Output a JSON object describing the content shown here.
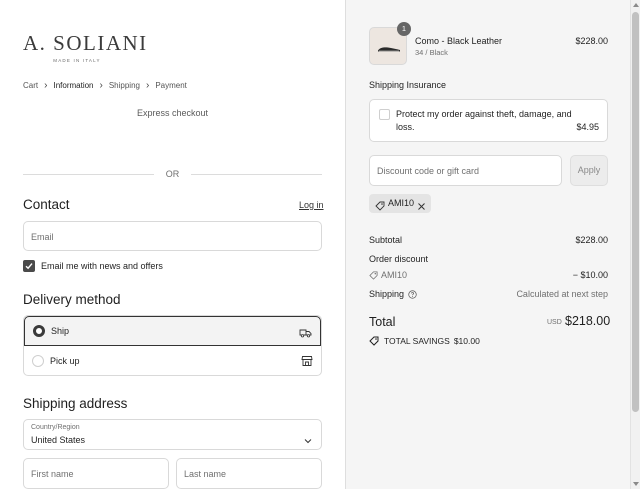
{
  "brand": {
    "name": "A. SOLIANI",
    "tagline": "MADE IN ITALY"
  },
  "breadcrumb": [
    {
      "label": "Cart",
      "active": false
    },
    {
      "label": "Information",
      "active": true
    },
    {
      "label": "Shipping",
      "active": false
    },
    {
      "label": "Payment",
      "active": false
    }
  ],
  "express_checkout": "Express checkout",
  "divider_or": "OR",
  "contact": {
    "heading": "Contact",
    "login_label": "Log in",
    "email_placeholder": "Email",
    "news_checkbox_label": "Email me with news and offers",
    "news_checked": true
  },
  "delivery": {
    "heading": "Delivery method",
    "options": [
      {
        "label": "Ship",
        "selected": true,
        "icon": "truck-icon"
      },
      {
        "label": "Pick up",
        "selected": false,
        "icon": "store-icon"
      }
    ]
  },
  "shipping_address": {
    "heading": "Shipping address",
    "country_label": "Country/Region",
    "country_value": "United States",
    "first_name_placeholder": "First name",
    "last_name_placeholder": "Last name"
  },
  "order": {
    "item": {
      "quantity": "1",
      "name": "Como - Black Leather",
      "variant": "34 / Black",
      "price": "$228.00"
    },
    "insurance": {
      "title": "Shipping Insurance",
      "text": "Protect my order against theft, damage, and loss.",
      "price": "$4.95",
      "checked": false
    },
    "discount": {
      "placeholder": "Discount code or gift card",
      "apply_label": "Apply",
      "applied_code": "AMI10"
    },
    "summary": {
      "subtotal_label": "Subtotal",
      "subtotal_value": "$228.00",
      "order_discount_label": "Order discount",
      "discount_code": "AMI10",
      "discount_value": "− $10.00",
      "shipping_label": "Shipping",
      "shipping_value": "Calculated at next step",
      "total_label": "Total",
      "total_currency": "USD",
      "total_value": "$218.00",
      "savings_label": "TOTAL SAVINGS",
      "savings_value": "$10.00"
    }
  },
  "colors": {
    "sidebar_bg": "#f5f5f5",
    "accent_dark": "#3a3a3a",
    "border": "#d9d9d9"
  }
}
